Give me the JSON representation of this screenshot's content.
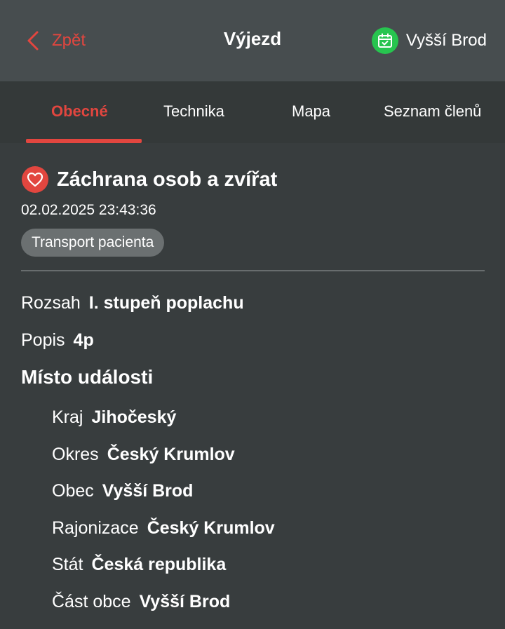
{
  "header": {
    "back_label": "Zpět",
    "title": "Výjezd",
    "station": "Vyšší Brod",
    "back_icon": "chevron-left-icon",
    "station_icon": "calendar-check-icon",
    "accent_color": "#e2463f",
    "station_icon_color": "#27c44f"
  },
  "tabs": [
    {
      "label": "Obecné",
      "active": true
    },
    {
      "label": "Technika",
      "active": false
    },
    {
      "label": "Mapa",
      "active": false
    },
    {
      "label": "Seznam členů",
      "active": false
    }
  ],
  "incident": {
    "icon": "heart-icon",
    "title": "Záchrana osob a zvířat",
    "datetime": "02.02.2025 23:43:36",
    "tag": "Transport pacienta"
  },
  "details": {
    "rozsah": {
      "label": "Rozsah",
      "value": "I. stupeň poplachu"
    },
    "popis": {
      "label": "Popis",
      "value": "4p"
    }
  },
  "location": {
    "title": "Místo události",
    "fields": [
      {
        "label": "Kraj",
        "value": "Jihočeský"
      },
      {
        "label": "Okres",
        "value": "Český Krumlov"
      },
      {
        "label": "Obec",
        "value": "Vyšší Brod"
      },
      {
        "label": "Rajonizace",
        "value": "Český Krumlov"
      },
      {
        "label": "Stát",
        "value": "Česká republika"
      },
      {
        "label": "Část obce",
        "value": "Vyšší Brod"
      }
    ]
  }
}
